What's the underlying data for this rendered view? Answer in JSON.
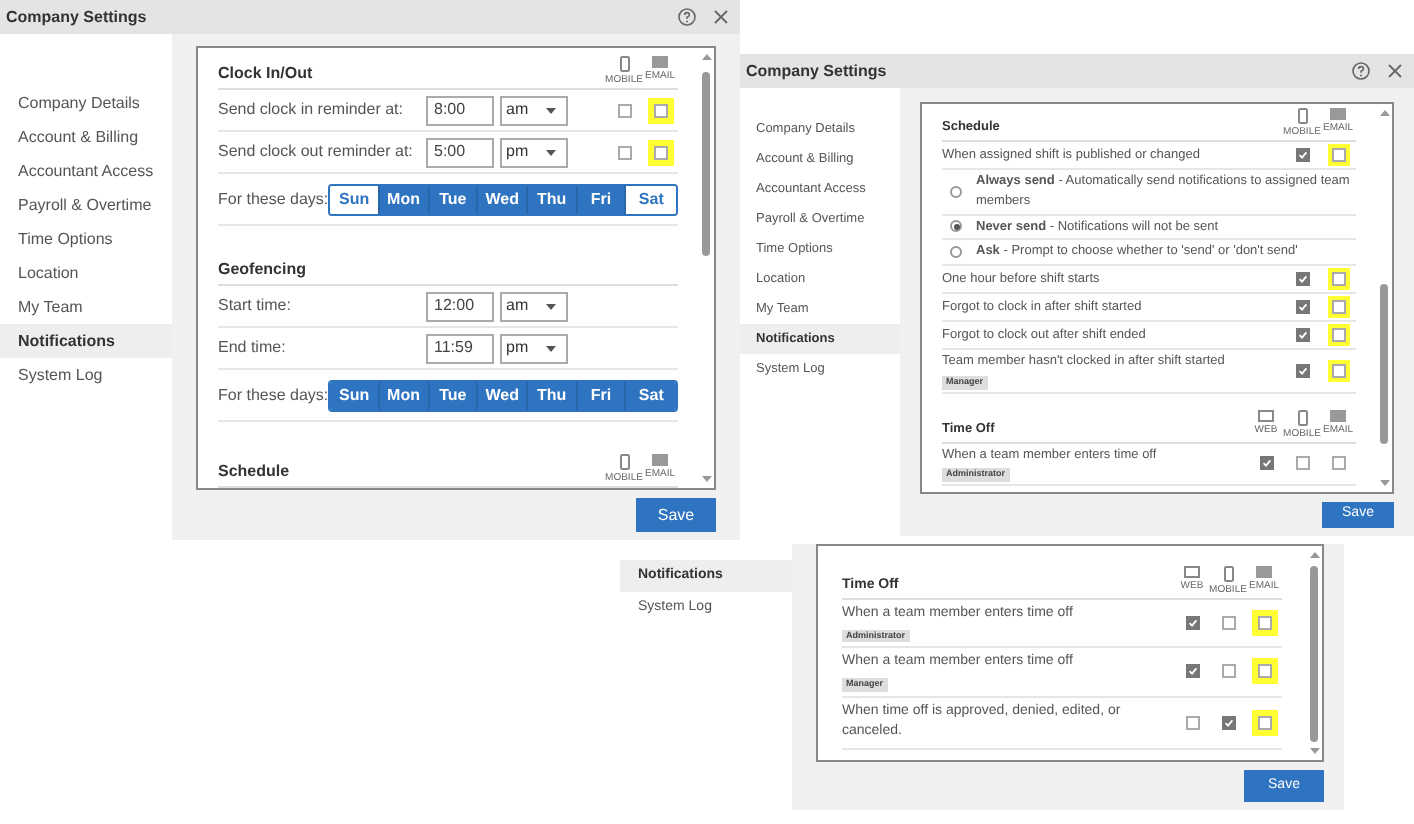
{
  "windows": [
    {
      "title": "Company Settings",
      "sidebar": [
        {
          "label": "Company Details",
          "selected": false
        },
        {
          "label": "Account & Billing",
          "selected": false
        },
        {
          "label": "Accountant Access",
          "selected": false
        },
        {
          "label": "Payroll & Overtime",
          "selected": false
        },
        {
          "label": "Time Options",
          "selected": false
        },
        {
          "label": "Location",
          "selected": false
        },
        {
          "label": "My Team",
          "selected": false
        },
        {
          "label": "Notifications",
          "selected": true
        },
        {
          "label": "System Log",
          "selected": false
        }
      ],
      "sections": [
        {
          "title": "Clock In/Out",
          "channels": [
            {
              "kind": "mobile",
              "label": "MOBILE"
            },
            {
              "kind": "email",
              "label": "EMAIL"
            }
          ],
          "rows": [
            {
              "kind": "time",
              "label": "Send clock in reminder at:",
              "value": "8:00",
              "period": "am",
              "checks": [
                {
                  "checked": false,
                  "highlighted": false
                },
                {
                  "checked": false,
                  "highlighted": true
                }
              ]
            },
            {
              "kind": "time",
              "label": "Send clock out reminder at:",
              "value": "5:00",
              "period": "pm",
              "checks": [
                {
                  "checked": false,
                  "highlighted": false
                },
                {
                  "checked": false,
                  "highlighted": true
                }
              ]
            },
            {
              "kind": "days",
              "label": "For these days:",
              "days": [
                {
                  "label": "Sun",
                  "selected": false
                },
                {
                  "label": "Mon",
                  "selected": true
                },
                {
                  "label": "Tue",
                  "selected": true
                },
                {
                  "label": "Wed",
                  "selected": true
                },
                {
                  "label": "Thu",
                  "selected": true
                },
                {
                  "label": "Fri",
                  "selected": true
                },
                {
                  "label": "Sat",
                  "selected": false
                }
              ]
            }
          ]
        },
        {
          "title": "Geofencing",
          "rows": [
            {
              "kind": "time",
              "label": "Start time:",
              "value": "12:00",
              "period": "am"
            },
            {
              "kind": "time",
              "label": "End time:",
              "value": "11:59",
              "period": "pm"
            },
            {
              "kind": "days",
              "label": "For these days:",
              "days": [
                {
                  "label": "Sun",
                  "selected": true
                },
                {
                  "label": "Mon",
                  "selected": true
                },
                {
                  "label": "Tue",
                  "selected": true
                },
                {
                  "label": "Wed",
                  "selected": true
                },
                {
                  "label": "Thu",
                  "selected": true
                },
                {
                  "label": "Fri",
                  "selected": true
                },
                {
                  "label": "Sat",
                  "selected": true
                }
              ]
            }
          ]
        },
        {
          "title": "Schedule",
          "channels": [
            {
              "kind": "mobile",
              "label": "MOBILE"
            },
            {
              "kind": "email",
              "label": "EMAIL"
            }
          ]
        }
      ],
      "save": "Save"
    },
    {
      "title": "Company Settings",
      "sidebar": [
        {
          "label": "Company Details",
          "selected": false
        },
        {
          "label": "Account & Billing",
          "selected": false
        },
        {
          "label": "Accountant Access",
          "selected": false
        },
        {
          "label": "Payroll & Overtime",
          "selected": false
        },
        {
          "label": "Time Options",
          "selected": false
        },
        {
          "label": "Location",
          "selected": false
        },
        {
          "label": "My Team",
          "selected": false
        },
        {
          "label": "Notifications",
          "selected": true
        },
        {
          "label": "System Log",
          "selected": false
        }
      ],
      "sections": [
        {
          "title": "Schedule",
          "channels": [
            {
              "kind": "mobile",
              "label": "MOBILE"
            },
            {
              "kind": "email",
              "label": "EMAIL"
            }
          ],
          "rows": [
            {
              "kind": "notify",
              "label": "When assigned shift is published or changed",
              "checks": [
                {
                  "checked": true,
                  "highlighted": false
                },
                {
                  "checked": false,
                  "highlighted": true
                }
              ]
            },
            {
              "kind": "option",
              "text": "**Always send** - Automatically send notifications to assigned team members",
              "selected": false
            },
            {
              "kind": "option",
              "text": "**Never send** - Notifications will not be sent",
              "selected": true
            },
            {
              "kind": "option",
              "text": "**Ask** - Prompt to choose whether to 'send' or 'don't send'",
              "selected": false
            },
            {
              "kind": "notify",
              "label": "One hour before shift starts",
              "checks": [
                {
                  "checked": true,
                  "highlighted": false
                },
                {
                  "checked": false,
                  "highlighted": true
                }
              ]
            },
            {
              "kind": "notify",
              "label": "Forgot to clock in after shift started",
              "checks": [
                {
                  "checked": true,
                  "highlighted": false
                },
                {
                  "checked": false,
                  "highlighted": true
                }
              ]
            },
            {
              "kind": "notify",
              "label": "Forgot to clock out after shift ended",
              "checks": [
                {
                  "checked": true,
                  "highlighted": false
                },
                {
                  "checked": false,
                  "highlighted": true
                }
              ]
            },
            {
              "kind": "notify",
              "label": "Team member hasn't clocked in after shift started",
              "badge": "Manager",
              "checks": [
                {
                  "checked": true,
                  "highlighted": false
                },
                {
                  "checked": false,
                  "highlighted": true
                }
              ]
            }
          ]
        },
        {
          "title": "Time Off",
          "channels": [
            {
              "kind": "web",
              "label": "WEB"
            },
            {
              "kind": "mobile",
              "label": "MOBILE"
            },
            {
              "kind": "email",
              "label": "EMAIL"
            }
          ],
          "rows": [
            {
              "kind": "notify",
              "label": "When a team member enters time off",
              "badge": "Administrator",
              "checks": [
                {
                  "checked": true,
                  "highlighted": false
                },
                {
                  "checked": false,
                  "highlighted": false
                },
                {
                  "checked": false,
                  "highlighted": false
                }
              ]
            }
          ]
        }
      ],
      "save": "Save"
    },
    {
      "sidebar": [
        {
          "label": "Notifications",
          "selected": true
        },
        {
          "label": "System Log",
          "selected": false
        }
      ],
      "sections": [
        {
          "title": "Time Off",
          "channels": [
            {
              "kind": "web",
              "label": "WEB"
            },
            {
              "kind": "mobile",
              "label": "MOBILE"
            },
            {
              "kind": "email",
              "label": "EMAIL"
            }
          ],
          "rows": [
            {
              "kind": "notify",
              "label": "When a team member enters time off",
              "badge": "Administrator",
              "checks": [
                {
                  "checked": true,
                  "highlighted": false
                },
                {
                  "checked": false,
                  "highlighted": false
                },
                {
                  "checked": false,
                  "highlighted": true
                }
              ]
            },
            {
              "kind": "notify",
              "label": "When a team member enters time off",
              "badge": "Manager",
              "checks": [
                {
                  "checked": true,
                  "highlighted": false
                },
                {
                  "checked": false,
                  "highlighted": false
                },
                {
                  "checked": false,
                  "highlighted": true
                }
              ]
            },
            {
              "kind": "notify",
              "label": "When time off is approved, denied, edited, or canceled.",
              "checks": [
                {
                  "checked": false,
                  "highlighted": false
                },
                {
                  "checked": true,
                  "highlighted": false
                },
                {
                  "checked": false,
                  "highlighted": true
                }
              ]
            }
          ]
        }
      ],
      "save": "Save"
    }
  ]
}
